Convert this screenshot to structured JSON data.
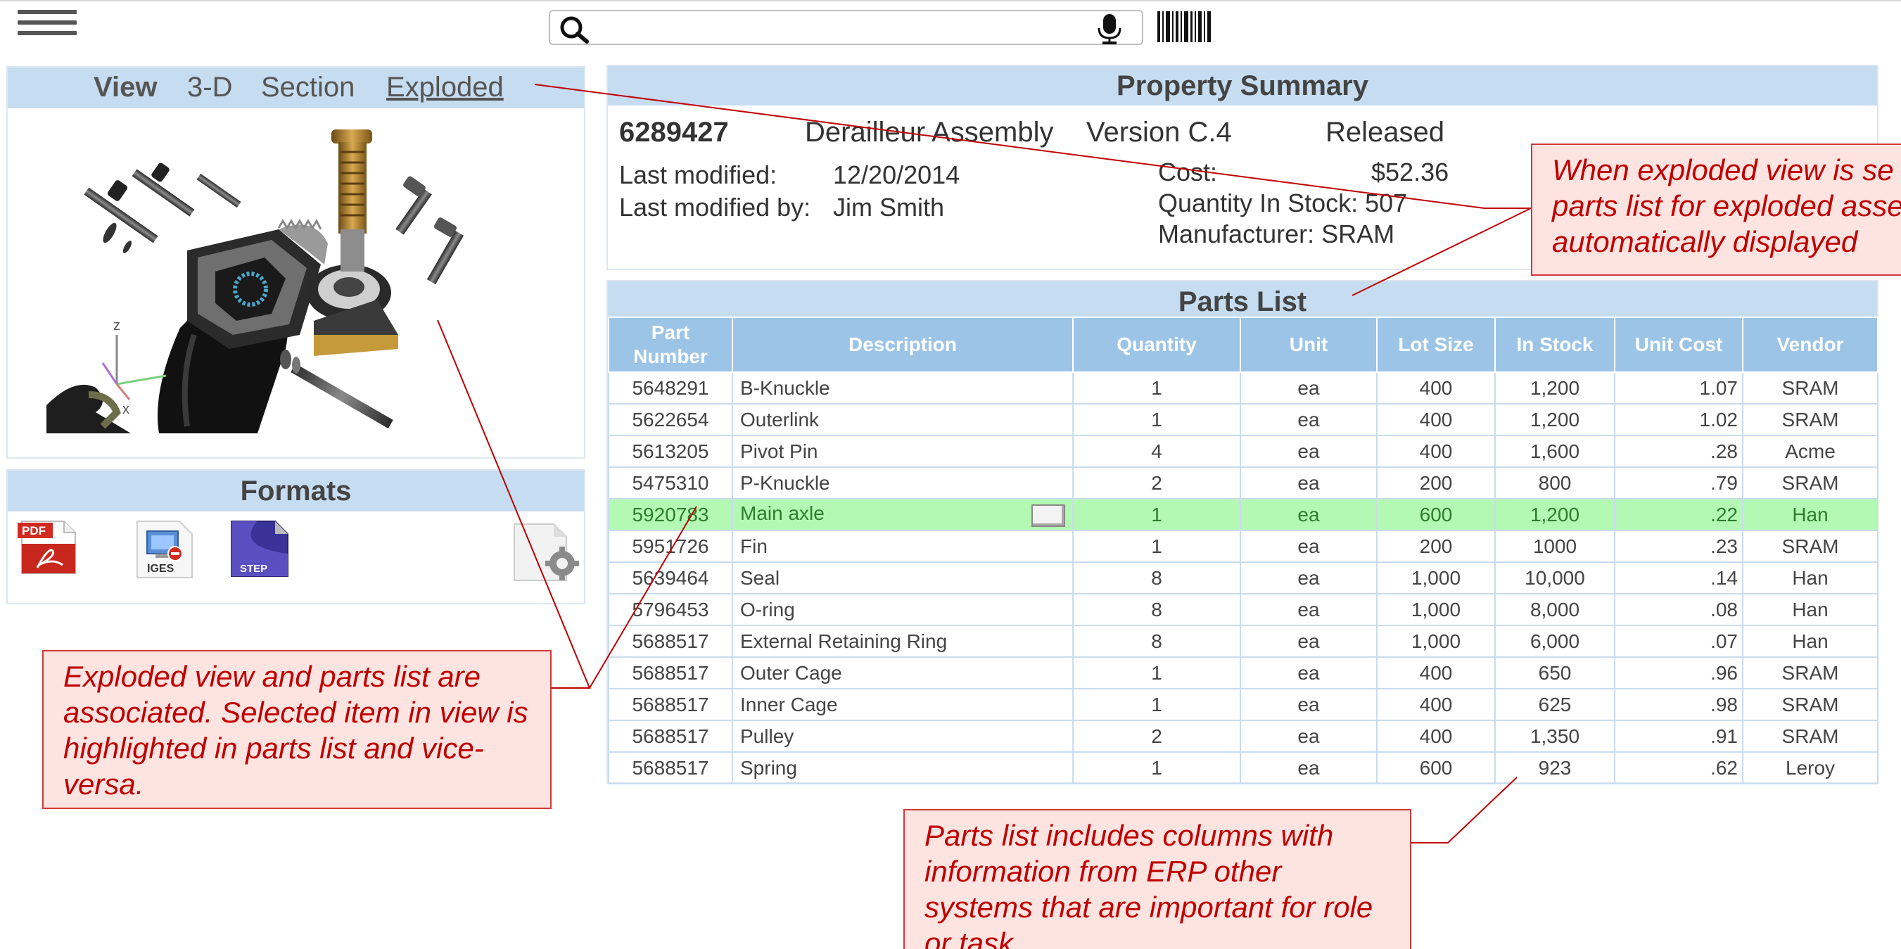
{
  "search": {
    "value": "",
    "placeholder": ""
  },
  "view": {
    "label": "View",
    "options": [
      "3-D",
      "Section",
      "Exploded"
    ],
    "selected": "Exploded"
  },
  "formats": {
    "title": "Formats",
    "icons": [
      {
        "name": "pdf-icon",
        "label": "PDF"
      },
      {
        "name": "iges-icon",
        "label": "IGES"
      },
      {
        "name": "step-icon",
        "label": "STEP"
      },
      {
        "name": "settings-file-icon",
        "label": ""
      }
    ]
  },
  "summary": {
    "title": "Property Summary",
    "part_number": "6289427",
    "name": "Derailleur Assembly",
    "version": "Version C.4",
    "status": "Released",
    "last_modified_label": "Last modified:",
    "last_modified": "12/20/2014",
    "last_modified_by_label": "Last modified by:",
    "last_modified_by": "Jim Smith",
    "cost_label": "Cost:",
    "cost": "$52.36",
    "quantity_in_stock": "Quantity In Stock: 507",
    "manufacturer": "Manufacturer: SRAM"
  },
  "parts": {
    "title": "Parts List",
    "columns": [
      "Part Number",
      "Description",
      "Quantity",
      "Unit",
      "Lot Size",
      "In Stock",
      "Unit Cost",
      "Vendor"
    ],
    "selected_row": 4,
    "rows": [
      [
        "5648291",
        "B-Knuckle",
        "1",
        "ea",
        "400",
        "1,200",
        "1.07",
        "SRAM"
      ],
      [
        "5622654",
        "Outerlink",
        "1",
        "ea",
        "400",
        "1,200",
        "1.02",
        "SRAM"
      ],
      [
        "5613205",
        "Pivot Pin",
        "4",
        "ea",
        "400",
        "1,600",
        ".28",
        "Acme"
      ],
      [
        "5475310",
        "P-Knuckle",
        "2",
        "ea",
        "200",
        "800",
        ".79",
        "SRAM"
      ],
      [
        "5920783",
        "Main axle",
        "1",
        "ea",
        "600",
        "1,200",
        ".22",
        "Han"
      ],
      [
        "5951726",
        "Fin",
        "1",
        "ea",
        "200",
        "1000",
        ".23",
        "SRAM"
      ],
      [
        "5639464",
        "Seal",
        "8",
        "ea",
        "1,000",
        "10,000",
        ".14",
        "Han"
      ],
      [
        "5796453",
        "O-ring",
        "8",
        "ea",
        "1,000",
        "8,000",
        ".08",
        "Han"
      ],
      [
        "5688517",
        "External Retaining Ring",
        "8",
        "ea",
        "1,000",
        "6,000",
        ".07",
        "Han"
      ],
      [
        "5688517",
        "Outer Cage",
        "1",
        "ea",
        "400",
        "650",
        ".96",
        "SRAM"
      ],
      [
        "5688517",
        "Inner Cage",
        "1",
        "ea",
        "400",
        "625",
        ".98",
        "SRAM"
      ],
      [
        "5688517",
        "Pulley",
        "2",
        "ea",
        "400",
        "1,350",
        ".91",
        "SRAM"
      ],
      [
        "5688517",
        "Spring",
        "1",
        "ea",
        "600",
        "923",
        ".62",
        "Leroy"
      ]
    ]
  },
  "callouts": {
    "top": [
      "When exploded view is se",
      "parts list for exploded asse",
      "automatically displayed"
    ],
    "left": "Exploded view and parts list are associated.  Selected item in view is highlighted in parts list and vice-versa.",
    "bottom": "Parts list includes columns with information from ERP other systems that are important for role or task"
  },
  "colors": {
    "panel_header": "#c6dcf0",
    "table_header": "#9cc4e6",
    "selected_row": "#b3f9b3",
    "callout_fill": "#fde4e1",
    "callout_text": "#c00000"
  }
}
